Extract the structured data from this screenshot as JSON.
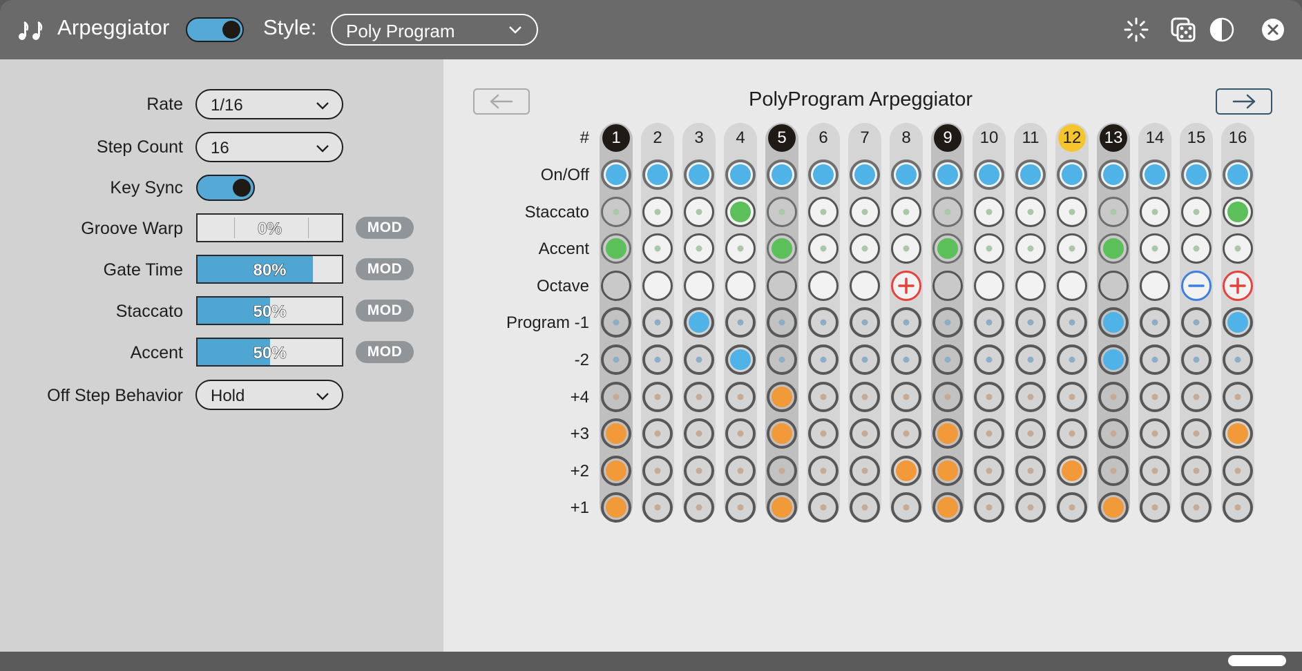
{
  "titlebar": {
    "title": "Arpeggiator",
    "power_on": true,
    "style_label": "Style:",
    "style_value": "Poly Program"
  },
  "settings": {
    "rate_label": "Rate",
    "rate_value": "1/16",
    "step_count_label": "Step Count",
    "step_count_value": "16",
    "key_sync_label": "Key Sync",
    "key_sync_on": true,
    "groove_warp_label": "Groove Warp",
    "groove_warp_value": "0%",
    "groove_warp_fraction": 0,
    "gate_time_label": "Gate Time",
    "gate_time_value": "80%",
    "gate_time_fraction": 0.8,
    "staccato_label": "Staccato",
    "staccato_value": "50%",
    "staccato_fraction": 0.5,
    "accent_label": "Accent",
    "accent_value": "50%",
    "accent_fraction": 0.5,
    "mod_label": "MOD",
    "off_step_label": "Off Step Behavior",
    "off_step_value": "Hold"
  },
  "grid": {
    "title": "PolyProgram Arpeggiator",
    "hash_label": "#",
    "steps": [
      "1",
      "2",
      "3",
      "4",
      "5",
      "6",
      "7",
      "8",
      "9",
      "10",
      "11",
      "12",
      "13",
      "14",
      "15",
      "16"
    ],
    "dark_steps": [
      1,
      5,
      9,
      13
    ],
    "current_step": 12,
    "rows": {
      "onoff": "On/Off",
      "staccato": "Staccato",
      "accent": "Accent",
      "octave": "Octave",
      "program_m1": "Program -1",
      "m2": "-2",
      "p4": "+4",
      "p3": "+3",
      "p2": "+2",
      "p1": "+1"
    },
    "onoff_active": [
      1,
      2,
      3,
      4,
      5,
      6,
      7,
      8,
      9,
      10,
      11,
      12,
      13,
      14,
      15,
      16
    ],
    "staccato_active": [
      4,
      16
    ],
    "accent_active": [
      1,
      5,
      9,
      13
    ],
    "octave_up": [
      8,
      16
    ],
    "octave_down": [
      15
    ],
    "prog_m1_active": [
      3,
      13,
      16
    ],
    "prog_m2_active": [
      4,
      13
    ],
    "prog_p4_active": [
      5
    ],
    "prog_p3_active": [
      1,
      5,
      9,
      16
    ],
    "prog_p2_active": [
      1,
      8,
      9,
      12
    ],
    "prog_p1_active": [
      1,
      5,
      9,
      13
    ]
  },
  "colors": {
    "blue": "#4fb3e8",
    "green": "#5bbf5a",
    "orange": "#f29a3a",
    "red": "#e8403a",
    "minus_blue": "#3d7fe0",
    "yellow": "#f5c52d"
  }
}
